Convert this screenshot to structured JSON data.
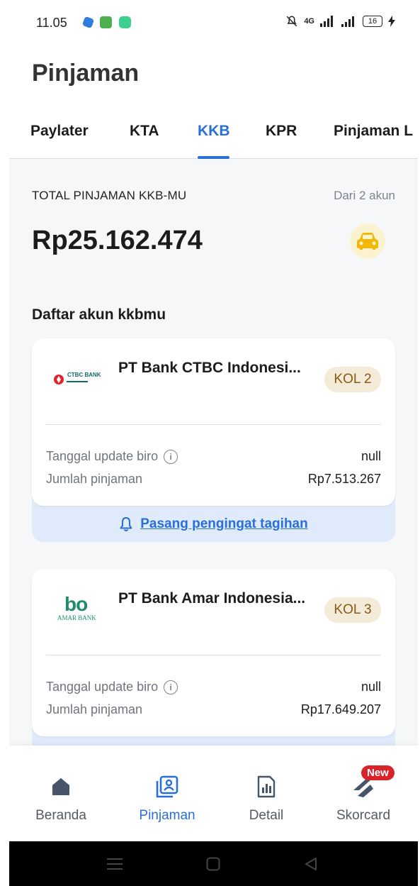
{
  "status_bar": {
    "time": "11.05",
    "network": "4G",
    "battery": "16"
  },
  "header": {
    "title": "Pinjaman",
    "tabs": [
      {
        "label": "Paylater"
      },
      {
        "label": "KTA"
      },
      {
        "label": "KKB"
      },
      {
        "label": "KPR"
      },
      {
        "label": "Pinjaman L"
      }
    ],
    "active_tab": "KKB"
  },
  "summary": {
    "label": "TOTAL PINJAMAN KKB-MU",
    "accounts_text": "Dari 2 akun",
    "total": "Rp25.162.474",
    "icon": "car-icon"
  },
  "list": {
    "title": "Daftar akun kkbmu",
    "accounts": [
      {
        "bank_name": "PT Bank CTBC Indonesi...",
        "logo_text": "CTBC BANK",
        "kol": "KOL 2",
        "update_label": "Tanggal update biro",
        "update_value": "null",
        "amount_label": "Jumlah pinjaman",
        "amount_value": "Rp7.513.267",
        "reminder": "Pasang pengingat tagihan"
      },
      {
        "bank_name": "PT Bank Amar Indonesia...",
        "logo_text": "bo",
        "logo_sub": "AMAR BANK",
        "kol": "KOL 3",
        "update_label": "Tanggal update biro",
        "update_value": "null",
        "amount_label": "Jumlah pinjaman",
        "amount_value": "Rp17.649.207"
      }
    ]
  },
  "bottom_nav": [
    {
      "label": "Beranda",
      "icon": "home-icon"
    },
    {
      "label": "Pinjaman",
      "icon": "loan-icon"
    },
    {
      "label": "Detail",
      "icon": "report-icon"
    },
    {
      "label": "Skorcard",
      "icon": "score-icon",
      "badge": "New"
    }
  ],
  "colors": {
    "accent": "#2a6fd6",
    "kol_bg": "#f3ead8",
    "kol_text": "#8a5a12",
    "badge": "#d8232a",
    "car_bg": "#fbf3cf",
    "car": "#f2b807"
  }
}
